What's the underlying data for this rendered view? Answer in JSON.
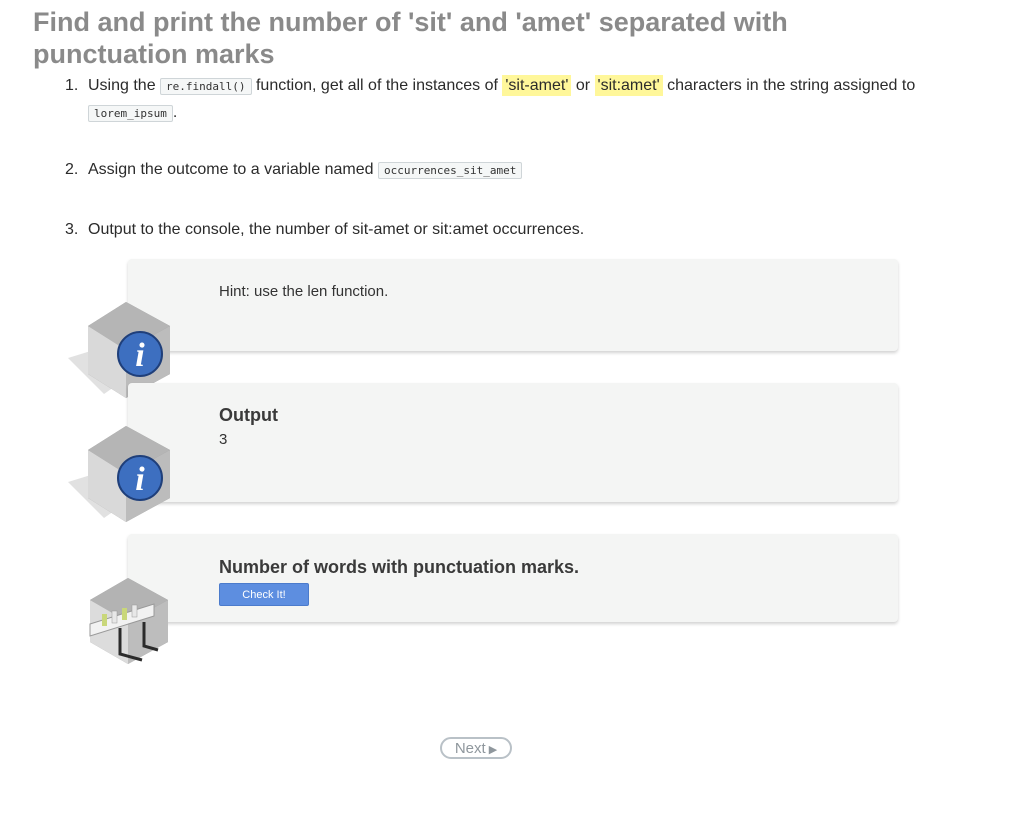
{
  "title": "Find and print the number of 'sit' and 'amet' separated with punctuation marks",
  "steps": [
    {
      "number": "1.",
      "text_a": "Using the",
      "code_a": "re.findall()",
      "text_b": "function, get all of the instances of",
      "highlight_a": "'sit-amet'",
      "text_c": "or",
      "highlight_b": "'sit:amet'",
      "text_d": "characters in the string assigned to",
      "code_b": "lorem_ipsum",
      "text_e": "."
    },
    {
      "number": "2.",
      "text_a": "Assign the outcome to a variable named",
      "code_a": "occurrences_sit_amet"
    },
    {
      "number": "3.",
      "text_a": "Output to the console, the number of sit-amet or sit:amet occurrences."
    }
  ],
  "hint": {
    "text": "Hint: use the len function.",
    "icon": "info-icon"
  },
  "output": {
    "heading": "Output",
    "value": "3",
    "icon": "info-icon"
  },
  "check": {
    "heading": "Number of words with punctuation marks.",
    "button_label": "Check It!",
    "icon": "test-tubes-icon"
  },
  "nav": {
    "next_label": "Next"
  },
  "colors": {
    "highlight": "#fff79a",
    "button": "#5d8ee0",
    "title": "#8a8a8a",
    "card": "#f4f5f4"
  }
}
